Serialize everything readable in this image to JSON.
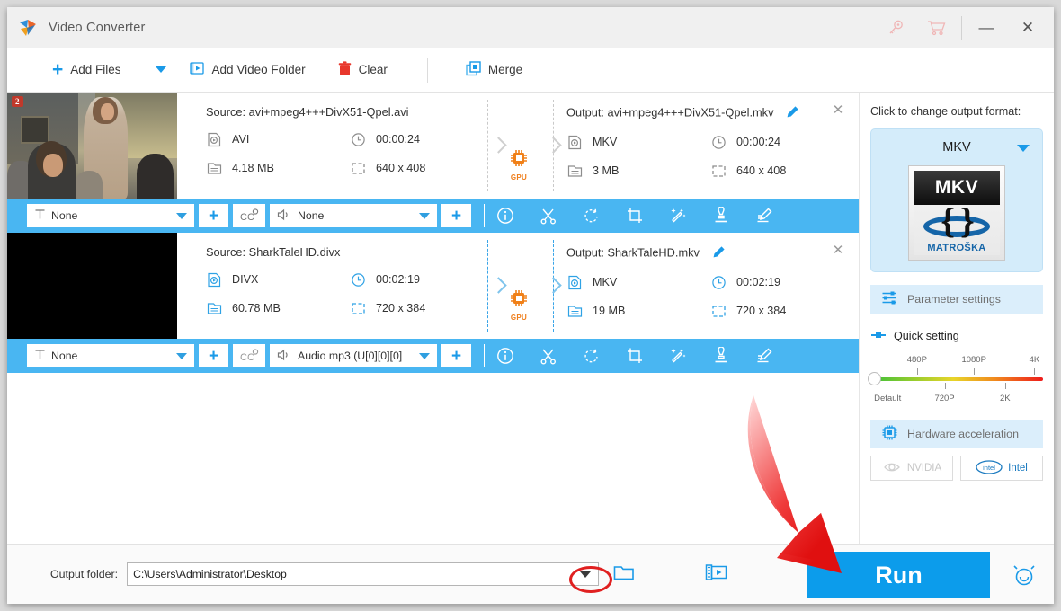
{
  "window": {
    "title": "Video Converter",
    "logo_icon": "app-logo-icon",
    "key_icon": "key-icon",
    "cart_icon": "cart-icon",
    "minimize": "—",
    "close": "✕"
  },
  "toolbar": {
    "add_files": "Add Files",
    "add_files_icon": "plus-icon",
    "add_files_caret": "chevron-down-icon",
    "add_video_folder": "Add Video Folder",
    "add_video_folder_icon": "video-folder-icon",
    "clear": "Clear",
    "clear_icon": "trash-icon",
    "merge": "Merge",
    "merge_icon": "merge-icon"
  },
  "files": [
    {
      "selected": false,
      "thumb": "classroom-thumbnail",
      "thumb_badge": "2",
      "source": {
        "title": "Source: avi+mpeg4+++DivX51-Qpel.avi",
        "format": "AVI",
        "duration": "00:00:24",
        "size": "4.18 MB",
        "resolution": "640 x 408"
      },
      "gpu_badge": "GPU",
      "output": {
        "title": "Output: avi+mpeg4+++DivX51-Qpel.mkv",
        "format": "MKV",
        "duration": "00:00:24",
        "size": "3 MB",
        "resolution": "640 x 408"
      },
      "actions": {
        "subtitle_value": "None",
        "audio_value": "None",
        "add_subtitle": "+",
        "add_audio": "+",
        "cc_label": "CC",
        "icons": [
          "info-icon",
          "cut-icon",
          "rotate-icon",
          "crop-icon",
          "effect-icon",
          "watermark-icon",
          "subtitle-edit-icon"
        ]
      }
    },
    {
      "selected": true,
      "thumb": "black-thumbnail",
      "thumb_badge": "",
      "source": {
        "title": "Source: SharkTaleHD.divx",
        "format": "DIVX",
        "duration": "00:02:19",
        "size": "60.78 MB",
        "resolution": "720 x 384"
      },
      "gpu_badge": "GPU",
      "output": {
        "title": "Output: SharkTaleHD.mkv",
        "format": "MKV",
        "duration": "00:02:19",
        "size": "19 MB",
        "resolution": "720 x 384"
      },
      "actions": {
        "subtitle_value": "None",
        "audio_value": "Audio mp3 (U[0][0][0]",
        "add_subtitle": "+",
        "add_audio": "+",
        "cc_label": "CC",
        "icons": [
          "info-icon",
          "cut-icon",
          "rotate-icon",
          "crop-icon",
          "effect-icon",
          "watermark-icon",
          "subtitle-edit-icon"
        ]
      }
    }
  ],
  "right_panel": {
    "prompt": "Click to change output format:",
    "format_name": "MKV",
    "format_logo_top": "MKV",
    "format_logo_brace": "{ }",
    "format_logo_word": "MATROŠKA",
    "parameter_settings": "Parameter settings",
    "parameter_icon": "sliders-icon",
    "quick_setting": "Quick setting",
    "quick_setting_icon": "slider-small-icon",
    "slider": {
      "ticks_top": [
        {
          "label": "480P",
          "pos": 27
        },
        {
          "label": "1080P",
          "pos": 60
        },
        {
          "label": "4K",
          "pos": 96
        }
      ],
      "ticks_bottom": [
        {
          "label": "Default",
          "pos": 3
        },
        {
          "label": "720P",
          "pos": 43
        },
        {
          "label": "2K",
          "pos": 78
        }
      ],
      "knob_pos": 0
    },
    "hardware_acceleration": "Hardware acceleration",
    "hardware_icon": "cpu-icon",
    "nvidia": "NVIDIA",
    "nvidia_enabled": false,
    "intel": "Intel",
    "intel_enabled": true
  },
  "bottom": {
    "output_folder_label": "Output folder:",
    "output_folder_value": "C:\\Users\\Administrator\\Desktop",
    "folder_icon": "folder-open-icon",
    "dropdown_icon": "chevron-down-icon",
    "media_icon": "video-file-icon",
    "run_label": "Run",
    "alarm_icon": "alarm-clock-icon"
  },
  "colors": {
    "accent_blue": "#0c9ceb",
    "bar_blue": "#49b6f2",
    "panel_blue": "#d4ecfa",
    "annotation_red": "#e02020",
    "gpu_orange": "#ef7d1a"
  }
}
